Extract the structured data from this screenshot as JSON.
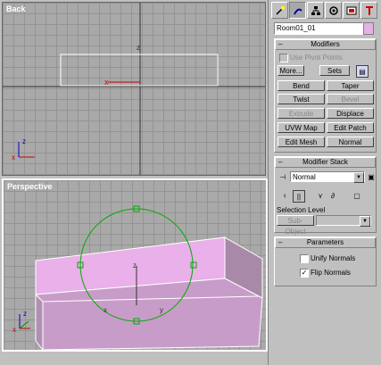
{
  "viewports": {
    "back": {
      "label": "Back"
    },
    "perspective": {
      "label": "Perspective"
    }
  },
  "axes": {
    "x": "x",
    "y": "y",
    "z": "z"
  },
  "command_panel": {
    "tabs": [
      "create-icon",
      "modify-icon",
      "hierarchy-icon",
      "motion-icon",
      "display-icon",
      "utilities-icon"
    ],
    "object_name": "Room01_01",
    "object_color": "#e6b0e6"
  },
  "modifiers": {
    "title": "Modifiers",
    "use_pivot_points": "Use Pivot Points",
    "more": "More...",
    "sets": "Sets",
    "buttons": [
      "Bend",
      "Taper",
      "Twist",
      "Bevel",
      "Extrude",
      "Displace",
      "UVW Map",
      "Edit Patch",
      "Edit Mesh",
      "Normal"
    ]
  },
  "modifier_stack": {
    "title": "Modifier Stack",
    "current": "Normal",
    "selection_level": "Selection Level",
    "sub_object": "Sub-Object"
  },
  "parameters": {
    "title": "Parameters",
    "unify_normals": "Unify Normals",
    "flip_normals": "Flip Normals",
    "unify_checked": false,
    "flip_checked": true
  },
  "colors": {
    "viewport_bg": "#a9a9a9",
    "grid": "#949494",
    "room_pink": "#e9b0e9",
    "gizmo": "#00aa00"
  }
}
